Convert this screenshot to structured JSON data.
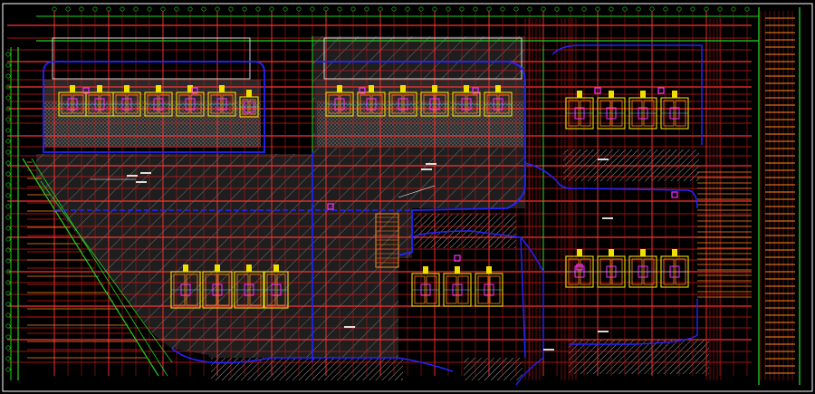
{
  "drawing": {
    "background": "#000000",
    "title_text": "",
    "colors": {
      "grid_red": "#d01818",
      "grid_red_bright": "#ff3030",
      "wall_green": "#21d321",
      "border_green": "#2bd42b",
      "slab_blue": "#2424ff",
      "hatch_gray": "#8c8c8c",
      "paving_white": "#d8d8d8",
      "yellow": "#f0e000",
      "orange": "#ff8a1a",
      "magenta": "#ff30ff",
      "cyan": "#33e0ff",
      "white": "#ffffff"
    },
    "blocks": [
      "building-block-1",
      "building-block-2",
      "building-block-3",
      "building-block-4",
      "building-block-5",
      "building-block-6"
    ],
    "annotations": [
      "dimension-labels",
      "axis-bubbles",
      "drainage-markers"
    ]
  }
}
